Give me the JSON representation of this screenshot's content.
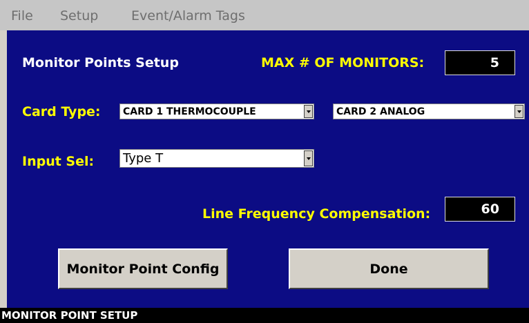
{
  "menu": {
    "file": "File",
    "setup": "Setup",
    "event_alarm_tags": "Event/Alarm Tags"
  },
  "panel": {
    "title": "Monitor Points Setup",
    "max_monitors_label": "MAX # OF MONITORS:",
    "max_monitors_value": "5",
    "card_type_label": "Card Type:",
    "card1_value": "CARD 1 THERMOCOUPLE",
    "card2_value": "CARD 2 ANALOG",
    "input_sel_label": "Input Sel:",
    "input_sel_value": "Type T",
    "line_freq_label": "Line Frequency Compensation:",
    "line_freq_value": "60",
    "monitor_point_config_button": "Monitor Point Config",
    "done_button": "Done"
  },
  "status_bar": {
    "text": "MONITOR POINT SETUP"
  },
  "colors": {
    "panel_bg": "#0c0c84",
    "label_yellow": "#ffff00",
    "label_white": "#ffffff",
    "menubar_bg": "#c6c6c6",
    "button_face": "#d4d0c8"
  },
  "icons": {
    "dropdown_arrow": "chevron-down-icon"
  }
}
